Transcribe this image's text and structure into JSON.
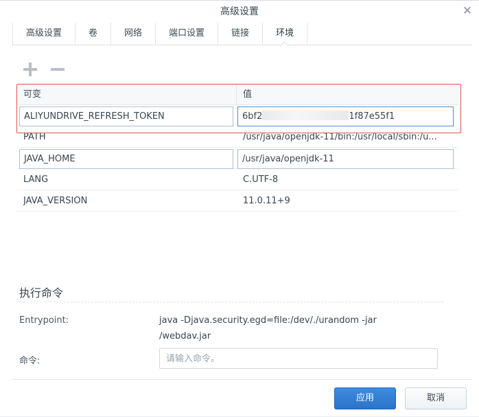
{
  "window": {
    "title": "高级设置",
    "close_glyph": "✕"
  },
  "tabs": [
    {
      "label": "高级设置"
    },
    {
      "label": "卷"
    },
    {
      "label": "网络"
    },
    {
      "label": "端口设置"
    },
    {
      "label": "链接"
    },
    {
      "label": "环境"
    }
  ],
  "active_tab": "环境",
  "toolbar": {
    "add_icon": "plus-icon",
    "remove_icon": "minus-icon"
  },
  "env_table": {
    "headers": {
      "variable": "可变",
      "value": "值"
    },
    "rows": [
      {
        "key": "ALIYUNDRIVE_REFRESH_TOKEN",
        "value_prefix": "6bf2",
        "value_suffix": "1f87e55f1"
      },
      {
        "key": "PATH",
        "value": "/usr/java/openjdk-11/bin:/usr/local/sbin:/u..."
      },
      {
        "key": "JAVA_HOME",
        "value": "/usr/java/openjdk-11"
      },
      {
        "key": "LANG",
        "value": "C.UTF-8"
      },
      {
        "key": "JAVA_VERSION",
        "value": "11.0.11+9"
      }
    ]
  },
  "exec_section": {
    "title": "执行命令",
    "entrypoint_label": "Entrypoint:",
    "entrypoint_value_line1": "java -Djava.security.egd=file:/dev/./urandom -jar",
    "entrypoint_value_line2": "/webdav.jar",
    "command_label": "命令:",
    "command_placeholder": "请输入命令。"
  },
  "footer": {
    "apply_label": "应用",
    "cancel_label": "取消"
  },
  "colors": {
    "primary": "#2a73c9",
    "highlight_border": "#d9534f"
  }
}
